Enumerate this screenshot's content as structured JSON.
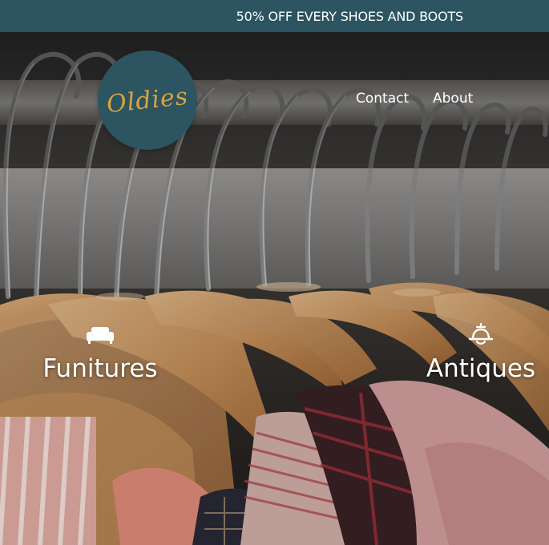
{
  "promo": {
    "text": "50% OFF EVERY SHOES AND BOOTS"
  },
  "header": {
    "logo_text": "Oldies",
    "nav": [
      {
        "label": "Contact"
      },
      {
        "label": "About"
      }
    ]
  },
  "categories": [
    {
      "label": "Funitures",
      "icon": "sofa-icon"
    },
    {
      "label": "Antiques",
      "icon": "bell-icon"
    }
  ],
  "colors": {
    "brand": "#2c5461",
    "logo_accent": "#d8a53f",
    "text_light": "#ffffff"
  }
}
